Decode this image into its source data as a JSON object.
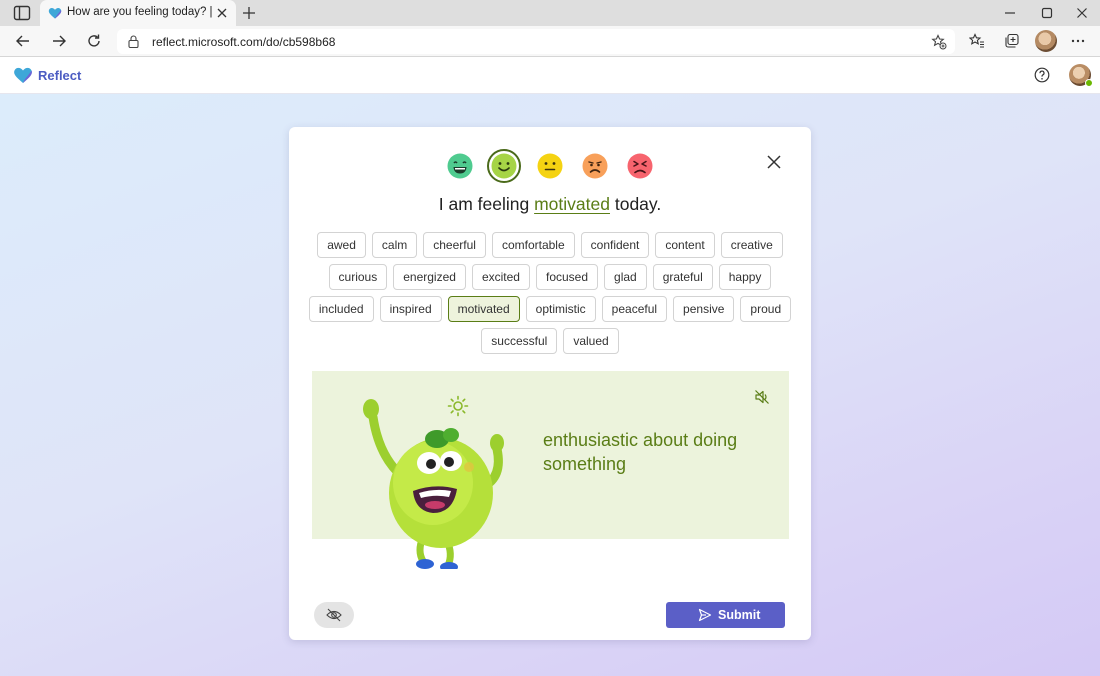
{
  "browser": {
    "tab_title": "How are you feeling today? | Microsoft Teams",
    "url": "reflect.microsoft.com/do/cb598b68"
  },
  "app": {
    "name": "Reflect"
  },
  "card": {
    "prefix": "I am feeling",
    "selected_feeling": "motivated",
    "suffix": "today.",
    "faces": [
      "very-happy-face-icon",
      "happy-face-icon",
      "neutral-face-icon",
      "sad-face-icon",
      "very-sad-face-icon"
    ],
    "selected_face_index": 1,
    "feeling_rows": [
      [
        "awed",
        "calm",
        "cheerful",
        "comfortable",
        "confident",
        "content",
        "creative"
      ],
      [
        "curious",
        "energized",
        "excited",
        "focused",
        "glad",
        "grateful",
        "happy"
      ],
      [
        "included",
        "inspired",
        "motivated",
        "optimistic",
        "peaceful",
        "pensive",
        "proud"
      ],
      [
        "successful",
        "valued"
      ]
    ],
    "description": "enthusiastic about doing something",
    "submit_label": "Submit"
  },
  "colors": {
    "accent": "#5b5fc7",
    "feeling_green": "#5a7d16",
    "illustration_bg": "#ecf3dc"
  }
}
